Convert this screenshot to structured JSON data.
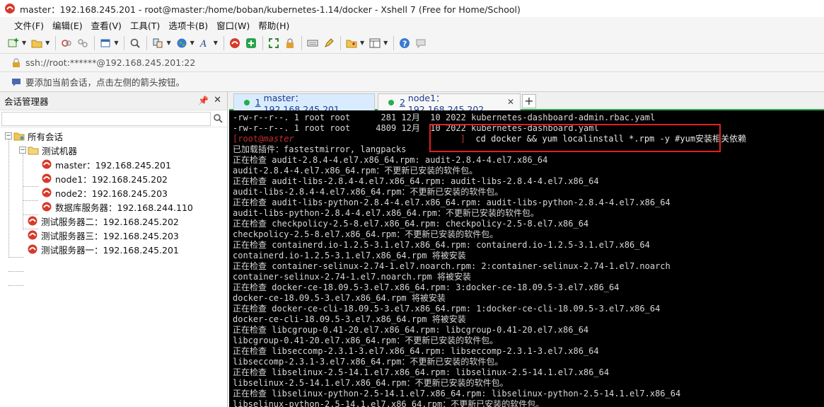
{
  "window": {
    "title": "master：192.168.245.201 - root@master:/home/boban/kubernetes-1.14/docker - Xshell 7 (Free for Home/School)"
  },
  "menu": [
    "文件(F)",
    "编辑(E)",
    "查看(V)",
    "工具(T)",
    "选项卡(B)",
    "窗口(W)",
    "帮助(H)"
  ],
  "address": {
    "url": "ssh://root:******@192.168.245.201:22"
  },
  "hint": {
    "text": "要添加当前会话，点击左侧的箭头按钮。"
  },
  "session_manager": {
    "title": "会话管理器",
    "search_value": "",
    "tree": {
      "root": "所有会话",
      "group": "测试机器",
      "group_children": [
        "master：192.168.245.201",
        "node1：192.168.245.202",
        "node2：192.168.245.203",
        "数据库服务器：192.168.244.110"
      ],
      "sessions": [
        "测试服务器二：192.168.245.202",
        "测试服务器三：192.168.245.203",
        "测试服务器一：192.168.245.201"
      ]
    }
  },
  "tabs": [
    {
      "num": "1",
      "name": "master：192.168.245.201",
      "active": true
    },
    {
      "num": "2",
      "name": "node1：192.168.245.202",
      "active": false
    }
  ],
  "tab_add": "+",
  "terminal": {
    "lines": [
      "-rw-r--r--. 1 root root      281 12月  10 2022 kubernetes-dashboard-admin.rbac.yaml",
      "-rw-r--r--. 1 root root     4809 12月  10 2022 kubernetes-dashboard.yaml"
    ],
    "prompt": {
      "open": "[",
      "user": "root",
      "at": "@",
      "host": "master",
      "close": "]",
      "command": "  cd docker && yum localinstall *.rpm -y #yum安装相关依赖"
    },
    "output": [
      "已加载插件：fastestmirror, langpacks",
      "正在检查 audit-2.8.4-4.el7.x86_64.rpm: audit-2.8.4-4.el7.x86_64",
      "audit-2.8.4-4.el7.x86_64.rpm：不更新已安装的软件包。",
      "正在检查 audit-libs-2.8.4-4.el7.x86_64.rpm: audit-libs-2.8.4-4.el7.x86_64",
      "audit-libs-2.8.4-4.el7.x86_64.rpm：不更新已安装的软件包。",
      "正在检查 audit-libs-python-2.8.4-4.el7.x86_64.rpm: audit-libs-python-2.8.4-4.el7.x86_64",
      "audit-libs-python-2.8.4-4.el7.x86_64.rpm：不更新已安装的软件包。",
      "正在检查 checkpolicy-2.5-8.el7.x86_64.rpm: checkpolicy-2.5-8.el7.x86_64",
      "checkpolicy-2.5-8.el7.x86_64.rpm：不更新已安装的软件包。",
      "正在检查 containerd.io-1.2.5-3.1.el7.x86_64.rpm: containerd.io-1.2.5-3.1.el7.x86_64",
      "containerd.io-1.2.5-3.1.el7.x86_64.rpm 将被安装",
      "正在检查 container-selinux-2.74-1.el7.noarch.rpm: 2:container-selinux-2.74-1.el7.noarch",
      "container-selinux-2.74-1.el7.noarch.rpm 将被安装",
      "正在检查 docker-ce-18.09.5-3.el7.x86_64.rpm: 3:docker-ce-18.09.5-3.el7.x86_64",
      "docker-ce-18.09.5-3.el7.x86_64.rpm 将被安装",
      "正在检查 docker-ce-cli-18.09.5-3.el7.x86_64.rpm: 1:docker-ce-cli-18.09.5-3.el7.x86_64",
      "docker-ce-cli-18.09.5-3.el7.x86_64.rpm 将被安装",
      "正在检查 libcgroup-0.41-20.el7.x86_64.rpm: libcgroup-0.41-20.el7.x86_64",
      "libcgroup-0.41-20.el7.x86_64.rpm：不更新已安装的软件包。",
      "正在检查 libseccomp-2.3.1-3.el7.x86_64.rpm: libseccomp-2.3.1-3.el7.x86_64",
      "libseccomp-2.3.1-3.el7.x86_64.rpm：不更新已安装的软件包。",
      "正在检查 libselinux-2.5-14.1.el7.x86_64.rpm: libselinux-2.5-14.1.el7.x86_64",
      "libselinux-2.5-14.1.el7.x86_64.rpm：不更新已安装的软件包。",
      "正在检查 libselinux-python-2.5-14.1.el7.x86_64.rpm: libselinux-python-2.5-14.1.el7.x86_64",
      "libselinux-python-2.5-14.1.el7.x86_64.rpm：不更新已安装的软件包。"
    ]
  },
  "icons": {
    "app": "xshell-icon",
    "session": "xshell-session-icon",
    "folder": "folder-icon",
    "lock": "lock-icon",
    "hint": "speech-bubble-icon",
    "search": "search-icon",
    "pin": "pin-icon",
    "close": "close-icon"
  },
  "colors": {
    "accent_green": "#2aa34a",
    "prompt_red": "#c03030",
    "highlight_red": "#e02020"
  }
}
